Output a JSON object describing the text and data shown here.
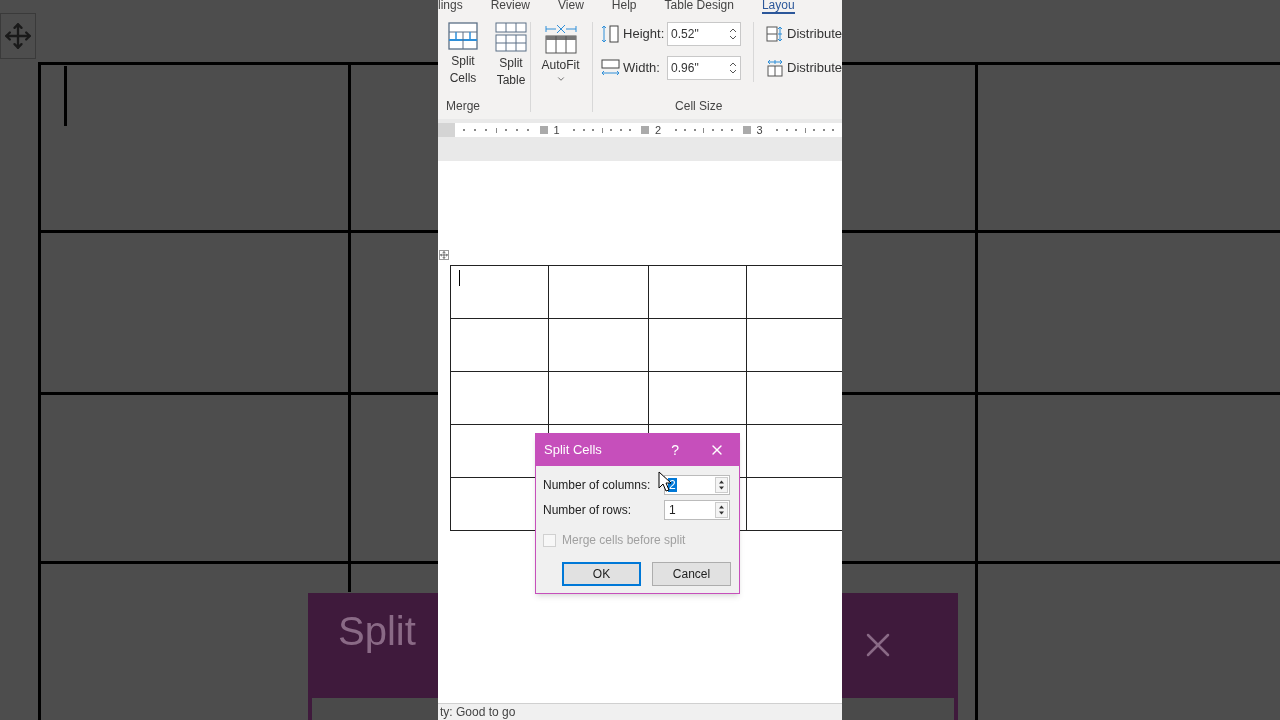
{
  "backdrop": {
    "dialog_title": "Split"
  },
  "ribbon_tabs": [
    {
      "label": "lings",
      "selected": false
    },
    {
      "label": "Review",
      "selected": false
    },
    {
      "label": "View",
      "selected": false
    },
    {
      "label": "Help",
      "selected": false
    },
    {
      "label": "Table Design",
      "selected": false
    },
    {
      "label": "Layou",
      "selected": true
    }
  ],
  "merge_group": {
    "label": "Merge",
    "buttons": [
      {
        "label": "Split Cells",
        "kind": "split-cells"
      },
      {
        "label": "Split Table",
        "kind": "split-table"
      }
    ]
  },
  "autofit": {
    "label": "AutoFit"
  },
  "cell_size_group": {
    "label": "Cell Size",
    "fields": [
      {
        "label": "Height:",
        "value": "0.52\"",
        "kind": "height"
      },
      {
        "label": "Width:",
        "value": "0.96\"",
        "kind": "width"
      }
    ],
    "distribute": [
      "Distribute",
      "Distribute"
    ]
  },
  "ruler": {
    "numbers": [
      "1",
      "2",
      "3"
    ]
  },
  "dialog": {
    "title": "Split Cells",
    "help": "?",
    "fields": [
      {
        "label": "Number of columns:",
        "value": "2",
        "selected": true
      },
      {
        "label": "Number of rows:",
        "value": "1",
        "selected": false
      }
    ],
    "checkbox": {
      "label": "Merge cells before split",
      "checked": false,
      "disabled": true
    },
    "buttons": [
      {
        "label": "OK",
        "selected": true
      },
      {
        "label": "Cancel",
        "selected": false
      }
    ]
  },
  "status_bar": "ty: Good to go"
}
